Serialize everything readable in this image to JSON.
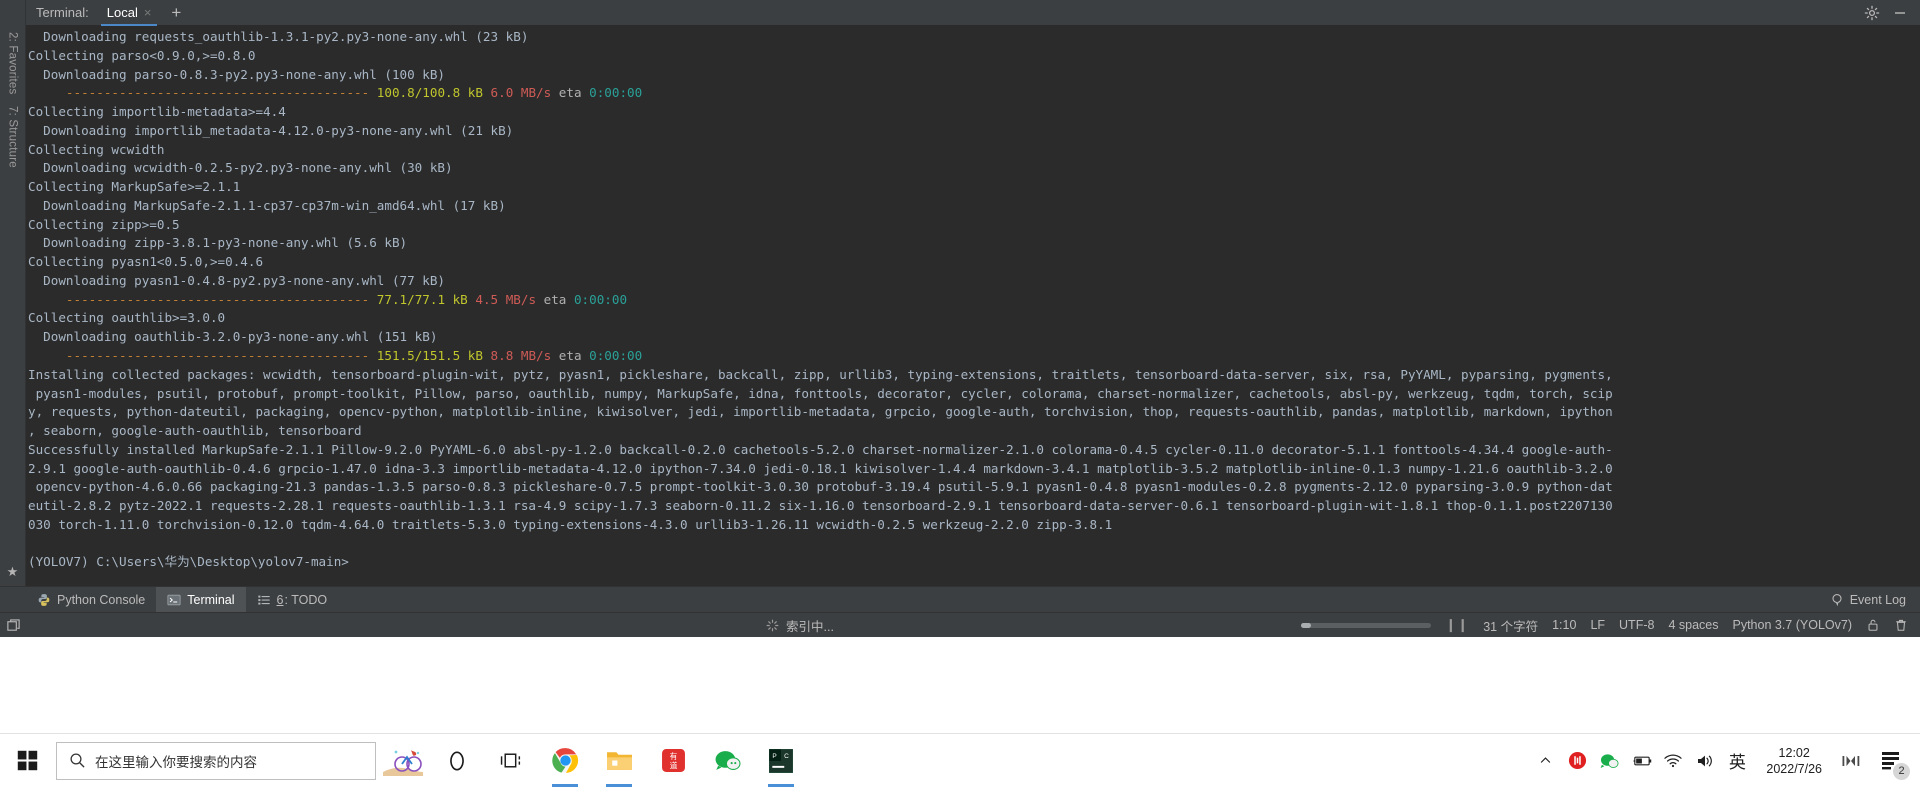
{
  "terminal_header": {
    "label": "Terminal:",
    "tabs": [
      {
        "name": "Local",
        "close": "×",
        "active": true
      }
    ],
    "add_tab": "+",
    "icons": [
      "gear-icon",
      "minimize-icon"
    ]
  },
  "left_rail": {
    "items": [
      "2: Favorites",
      "7: Structure"
    ],
    "star": "★"
  },
  "console": {
    "lines": [
      {
        "segs": [
          {
            "t": "  Downloading requests_oauthlib-1.3.1-py2.py3-none-any.whl (23 kB)",
            "c": "c-gray"
          }
        ]
      },
      {
        "segs": [
          {
            "t": "Collecting parso<0.9.0,>=0.8.0",
            "c": "c-gray"
          }
        ]
      },
      {
        "segs": [
          {
            "t": "  Downloading parso-0.8.3-py2.py3-none-any.whl (100 kB)",
            "c": "c-gray"
          }
        ]
      },
      {
        "segs": [
          {
            "t": "     ---------------------------------------- ",
            "c": "c-orange"
          },
          {
            "t": "100.8/100.8 kB",
            "c": "c-yellow"
          },
          {
            "t": " ",
            "c": "c-gray"
          },
          {
            "t": "6.0 MB/s",
            "c": "c-red"
          },
          {
            "t": " eta ",
            "c": "c-dim"
          },
          {
            "t": "0:00:00",
            "c": "c-cyan"
          }
        ]
      },
      {
        "segs": [
          {
            "t": "Collecting importlib-metadata>=4.4",
            "c": "c-gray"
          }
        ]
      },
      {
        "segs": [
          {
            "t": "  Downloading importlib_metadata-4.12.0-py3-none-any.whl (21 kB)",
            "c": "c-gray"
          }
        ]
      },
      {
        "segs": [
          {
            "t": "Collecting wcwidth",
            "c": "c-gray"
          }
        ]
      },
      {
        "segs": [
          {
            "t": "  Downloading wcwidth-0.2.5-py2.py3-none-any.whl (30 kB)",
            "c": "c-gray"
          }
        ]
      },
      {
        "segs": [
          {
            "t": "Collecting MarkupSafe>=2.1.1",
            "c": "c-gray"
          }
        ]
      },
      {
        "segs": [
          {
            "t": "  Downloading MarkupSafe-2.1.1-cp37-cp37m-win_amd64.whl (17 kB)",
            "c": "c-gray"
          }
        ]
      },
      {
        "segs": [
          {
            "t": "Collecting zipp>=0.5",
            "c": "c-gray"
          }
        ]
      },
      {
        "segs": [
          {
            "t": "  Downloading zipp-3.8.1-py3-none-any.whl (5.6 kB)",
            "c": "c-gray"
          }
        ]
      },
      {
        "segs": [
          {
            "t": "Collecting pyasn1<0.5.0,>=0.4.6",
            "c": "c-gray"
          }
        ]
      },
      {
        "segs": [
          {
            "t": "  Downloading pyasn1-0.4.8-py2.py3-none-any.whl (77 kB)",
            "c": "c-gray"
          }
        ]
      },
      {
        "segs": [
          {
            "t": "     ---------------------------------------- ",
            "c": "c-orange"
          },
          {
            "t": "77.1/77.1 kB",
            "c": "c-yellow"
          },
          {
            "t": " ",
            "c": "c-gray"
          },
          {
            "t": "4.5 MB/s",
            "c": "c-red"
          },
          {
            "t": " eta ",
            "c": "c-dim"
          },
          {
            "t": "0:00:00",
            "c": "c-cyan"
          }
        ]
      },
      {
        "segs": [
          {
            "t": "Collecting oauthlib>=3.0.0",
            "c": "c-gray"
          }
        ]
      },
      {
        "segs": [
          {
            "t": "  Downloading oauthlib-3.2.0-py3-none-any.whl (151 kB)",
            "c": "c-gray"
          }
        ]
      },
      {
        "segs": [
          {
            "t": "     ---------------------------------------- ",
            "c": "c-orange"
          },
          {
            "t": "151.5/151.5 kB",
            "c": "c-yellow"
          },
          {
            "t": " ",
            "c": "c-gray"
          },
          {
            "t": "8.8 MB/s",
            "c": "c-red"
          },
          {
            "t": " eta ",
            "c": "c-dim"
          },
          {
            "t": "0:00:00",
            "c": "c-cyan"
          }
        ]
      },
      {
        "segs": [
          {
            "t": "Installing collected packages: wcwidth, tensorboard-plugin-wit, pytz, pyasn1, pickleshare, backcall, zipp, urllib3, typing-extensions, traitlets, tensorboard-data-server, six, rsa, PyYAML, pyparsing, pygments,",
            "c": "c-gray"
          }
        ]
      },
      {
        "segs": [
          {
            "t": " pyasn1-modules, psutil, protobuf, prompt-toolkit, Pillow, parso, oauthlib, numpy, MarkupSafe, idna, fonttools, decorator, cycler, colorama, charset-normalizer, cachetools, absl-py, werkzeug, tqdm, torch, scip",
            "c": "c-gray"
          }
        ]
      },
      {
        "segs": [
          {
            "t": "y, requests, python-dateutil, packaging, opencv-python, matplotlib-inline, kiwisolver, jedi, importlib-metadata, grpcio, google-auth, torchvision, thop, requests-oauthlib, pandas, matplotlib, markdown, ipython",
            "c": "c-gray"
          }
        ]
      },
      {
        "segs": [
          {
            "t": ", seaborn, google-auth-oauthlib, tensorboard",
            "c": "c-gray"
          }
        ]
      },
      {
        "segs": [
          {
            "t": "Successfully installed MarkupSafe-2.1.1 Pillow-9.2.0 PyYAML-6.0 absl-py-1.2.0 backcall-0.2.0 cachetools-5.2.0 charset-normalizer-2.1.0 colorama-0.4.5 cycler-0.11.0 decorator-5.1.1 fonttools-4.34.4 google-auth-",
            "c": "c-gray"
          }
        ]
      },
      {
        "segs": [
          {
            "t": "2.9.1 google-auth-oauthlib-0.4.6 grpcio-1.47.0 idna-3.3 importlib-metadata-4.12.0 ipython-7.34.0 jedi-0.18.1 kiwisolver-1.4.4 markdown-3.4.1 matplotlib-3.5.2 matplotlib-inline-0.1.3 numpy-1.21.6 oauthlib-3.2.0",
            "c": "c-gray"
          }
        ]
      },
      {
        "segs": [
          {
            "t": " opencv-python-4.6.0.66 packaging-21.3 pandas-1.3.5 parso-0.8.3 pickleshare-0.7.5 prompt-toolkit-3.0.30 protobuf-3.19.4 psutil-5.9.1 pyasn1-0.4.8 pyasn1-modules-0.2.8 pygments-2.12.0 pyparsing-3.0.9 python-dat",
            "c": "c-gray"
          }
        ]
      },
      {
        "segs": [
          {
            "t": "eutil-2.8.2 pytz-2022.1 requests-2.28.1 requests-oauthlib-1.3.1 rsa-4.9 scipy-1.7.3 seaborn-0.11.2 six-1.16.0 tensorboard-2.9.1 tensorboard-data-server-0.6.1 tensorboard-plugin-wit-1.8.1 thop-0.1.1.post2207130",
            "c": "c-gray"
          }
        ]
      },
      {
        "segs": [
          {
            "t": "030 torch-1.11.0 torchvision-0.12.0 tqdm-4.64.0 traitlets-5.3.0 typing-extensions-4.3.0 urllib3-1.26.11 wcwidth-0.2.5 werkzeug-2.2.0 zipp-3.8.1",
            "c": "c-gray"
          }
        ]
      },
      {
        "segs": [
          {
            "t": "",
            "c": "c-gray"
          }
        ]
      },
      {
        "segs": [
          {
            "t": "(YOLOV7) C:\\Users\\华为\\Desktop\\yolov7-main>",
            "c": "c-gray"
          }
        ]
      }
    ]
  },
  "tool_window_bar": {
    "buttons": [
      {
        "label": "Python Console",
        "icon": "python-icon",
        "active": false
      },
      {
        "label": "Terminal",
        "icon": "terminal-icon",
        "active": true
      },
      {
        "label_prefix": "6",
        "label": ": TODO",
        "icon": "todo-icon",
        "active": false
      }
    ],
    "event_log": "Event Log",
    "event_log_icon": "balloon-icon"
  },
  "status_bar": {
    "corner_icon": "restore-layout-icon",
    "indexing_text": "索引中...",
    "indexing_icon": "spinner-icon",
    "progress_percent": 7,
    "pause_icon": "pause-icon",
    "char_count": "31 个字符",
    "caret": "1:10",
    "line_sep": "LF",
    "encoding": "UTF-8",
    "indent": "4 spaces",
    "interpreter": "Python 3.7 (YOLOv7)",
    "icons": [
      "lock-icon",
      "trash-icon"
    ]
  },
  "taskbar": {
    "start_icon": "windows-start-icon",
    "search_icon": "search-icon",
    "search_placeholder": "在这里输入你要搜索的内容",
    "apps": [
      {
        "name": "news-weather-icon",
        "running": false
      },
      {
        "name": "cortana-icon",
        "running": false
      },
      {
        "name": "task-view-icon",
        "running": false
      },
      {
        "name": "chrome-icon",
        "running": true
      },
      {
        "name": "file-explorer-icon",
        "running": true
      },
      {
        "name": "youdao-icon",
        "running": false
      },
      {
        "name": "wechat-devtools-icon",
        "running": false
      },
      {
        "name": "pycharm-icon",
        "running": true
      }
    ],
    "tray": [
      "show-hidden-icons-icon",
      "recording-icon",
      "nvidia-icon",
      "battery-icon",
      "wifi-icon",
      "volume-icon",
      "ime-icon"
    ],
    "ime_label": "英",
    "clock_time": "12:02",
    "clock_date": "2022/7/26",
    "action_center_icon": "action-center-icon",
    "notification_count": "2",
    "mini_icon": "mini-player-icon"
  }
}
